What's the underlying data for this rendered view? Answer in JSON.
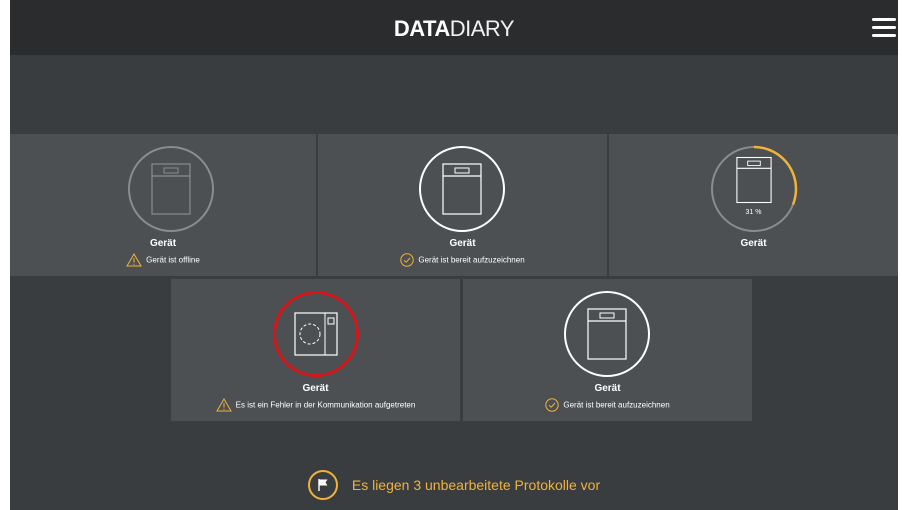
{
  "header": {
    "logo_bold": "DATA",
    "logo_light": "DIARY",
    "menu_icon": "hamburger-menu-icon"
  },
  "devices": [
    {
      "name": "Gerät",
      "status": "Gerät ist offline",
      "state": "offline",
      "status_icon": "warning-icon"
    },
    {
      "name": "Gerät",
      "status": "Gerät ist bereit aufzuzeichnen",
      "state": "ready",
      "status_icon": "check-circle-icon"
    },
    {
      "name": "Gerät",
      "progress_label": "31 %",
      "progress": 0.31,
      "state": "recording"
    },
    {
      "name": "Gerät",
      "status": "Es ist ein Fehler in der Kommunikation aufgetreten",
      "state": "error",
      "status_icon": "warning-icon"
    },
    {
      "name": "Gerät",
      "status": "Gerät ist bereit aufzuzeichnen",
      "state": "ready",
      "status_icon": "check-circle-icon"
    }
  ],
  "footer": {
    "text": "Es liegen 3 unbearbeitete Protokolle vor",
    "icon": "flag-icon"
  },
  "colors": {
    "accent": "#f0b23b",
    "error": "#d3171b",
    "tile": "#4c5052",
    "background": "#3a3d3f",
    "header": "#2b2c2e"
  }
}
